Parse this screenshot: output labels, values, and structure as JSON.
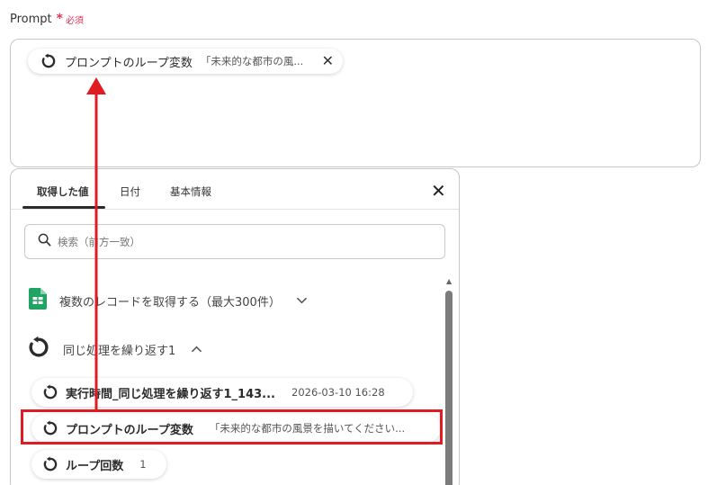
{
  "field": {
    "label": "Prompt",
    "asterisk": "*",
    "required": "必須"
  },
  "prompt_chip": {
    "label": "プロンプトのループ変数",
    "value": "「未来的な都市の風...",
    "close": "✕"
  },
  "panel": {
    "tabs": [
      "取得した値",
      "日付",
      "基本情報"
    ],
    "active_tab": 0,
    "close": "✕"
  },
  "search": {
    "placeholder": "検索（前方一致）"
  },
  "groups": [
    {
      "label": "複数のレコードを取得する（最大300件）",
      "icon": "spreadsheet-icon",
      "chevron": "⌄"
    },
    {
      "label": "同じ処理を繰り返す1",
      "icon": "loop-icon",
      "chevron": "^"
    }
  ],
  "rows": [
    {
      "label": "実行時間_同じ処理を繰り返す1_143...",
      "value": "2026-03-10 16:28"
    },
    {
      "label": "プロンプトのループ変数",
      "value": "「未来的な都市の風景を描いてください..."
    },
    {
      "label": "ループ回数",
      "value": "1"
    }
  ],
  "colors": {
    "accent_red": "#e01b22",
    "required_pink": "#e6325a",
    "sheet_green": "#1fa463"
  }
}
